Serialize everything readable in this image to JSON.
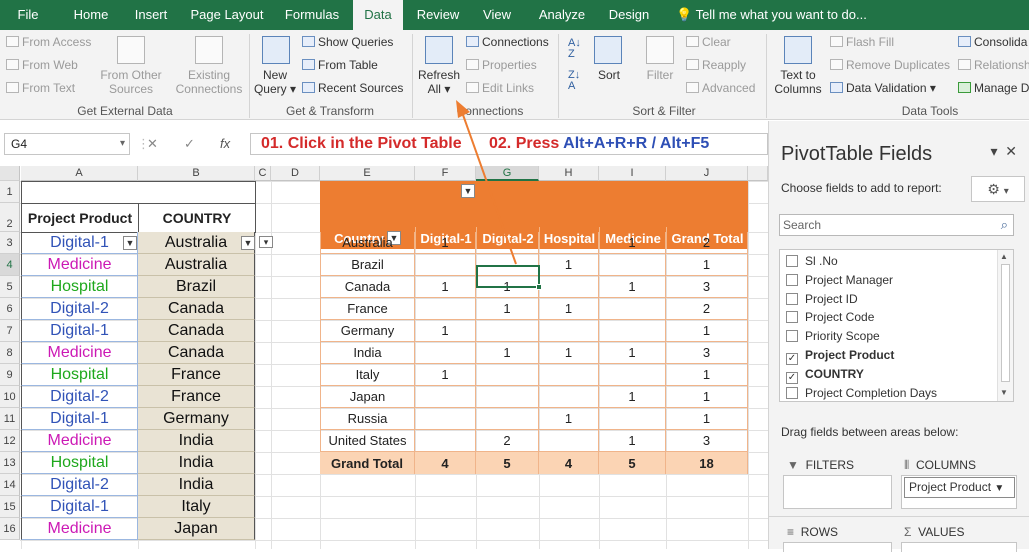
{
  "tabs": [
    {
      "label": "File",
      "active": false
    },
    {
      "label": "Home",
      "active": false
    },
    {
      "label": "Insert",
      "active": false
    },
    {
      "label": "Page Layout",
      "active": false
    },
    {
      "label": "Formulas",
      "active": false
    },
    {
      "label": "Data",
      "active": true
    },
    {
      "label": "Review",
      "active": false
    },
    {
      "label": "View",
      "active": false
    },
    {
      "label": "Analyze",
      "active": false
    },
    {
      "label": "Design",
      "active": false
    }
  ],
  "tell_me": "Tell me what you want to do...",
  "ribbon": {
    "get_external": {
      "from_access": "From Access",
      "from_web": "From Web",
      "from_text": "From Text",
      "from_other_1": "From Other",
      "from_other_2": "Sources",
      "existing_1": "Existing",
      "existing_2": "Connections",
      "group": "Get External Data"
    },
    "get_transform": {
      "new_query_1": "New",
      "new_query_2": "Query",
      "show_queries": "Show Queries",
      "from_table": "From Table",
      "recent_sources": "Recent Sources",
      "group": "Get & Transform"
    },
    "connections": {
      "refresh_1": "Refresh",
      "refresh_2": "All",
      "connections": "Connections",
      "properties": "Properties",
      "edit_links": "Edit Links",
      "group": "Connections"
    },
    "sort_filter": {
      "sort": "Sort",
      "filter": "Filter",
      "clear": "Clear",
      "reapply": "Reapply",
      "advanced": "Advanced",
      "group": "Sort & Filter"
    },
    "data_tools": {
      "text_to_1": "Text to",
      "text_to_2": "Columns",
      "flash_fill": "Flash Fill",
      "remove_duplicates": "Remove Duplicates",
      "data_validation": "Data Validation",
      "consolidate": "Consolida",
      "relationships": "Relationsh",
      "manage": "Manage D",
      "group": "Data Tools"
    }
  },
  "formula_bar": {
    "name_box": "G4",
    "fx": "fx",
    "cancel": "✕",
    "enter": "✓"
  },
  "instructions": {
    "step1": "01. Click in the Pivot Table",
    "step2_prefix": "02. Press ",
    "step2_key": "Alt+A+R+R",
    "step2_sep": " / ",
    "step2_key2": "Alt+F5"
  },
  "columns": [
    "A",
    "B",
    "C",
    "D",
    "E",
    "F",
    "G",
    "H",
    "I",
    "J"
  ],
  "rows": [
    "1",
    "2",
    "3",
    "4",
    "5",
    "6",
    "7",
    "8",
    "9",
    "10",
    "11",
    "12",
    "13",
    "14",
    "15",
    "16"
  ],
  "source_table": {
    "header_product": "Project Product",
    "header_country": "COUNTRY",
    "products": [
      "Digital-1",
      "Medicine",
      "Hospital",
      "Digital-2",
      "Digital-1",
      "Medicine",
      "Hospital",
      "Digital-2",
      "Digital-1",
      "Medicine",
      "Hospital",
      "Digital-2",
      "Digital-1",
      "Medicine"
    ],
    "countries": [
      "Australia",
      "Australia",
      "Brazil",
      "Canada",
      "Canada",
      "Canada",
      "France",
      "France",
      "Germany",
      "India",
      "India",
      "India",
      "Italy",
      "Japan"
    ]
  },
  "pivot": {
    "headers": [
      "Country",
      "Digital-1",
      "Digital-2",
      "Hospital",
      "Medicine",
      "Grand Total"
    ],
    "rows": [
      [
        "Australia",
        "1",
        "",
        "",
        "1",
        "2"
      ],
      [
        "Brazil",
        "",
        "",
        "1",
        "",
        "1"
      ],
      [
        "Canada",
        "1",
        "1",
        "",
        "1",
        "3"
      ],
      [
        "France",
        "",
        "1",
        "1",
        "",
        "2"
      ],
      [
        "Germany",
        "1",
        "",
        "",
        "",
        "1"
      ],
      [
        "India",
        "",
        "1",
        "1",
        "1",
        "3"
      ],
      [
        "Italy",
        "1",
        "",
        "",
        "",
        "1"
      ],
      [
        "Japan",
        "",
        "",
        "",
        "1",
        "1"
      ],
      [
        "Russia",
        "",
        "",
        "1",
        "",
        "1"
      ],
      [
        "United States",
        "",
        "2",
        "",
        "1",
        "3"
      ]
    ],
    "total": [
      "Grand Total",
      "4",
      "5",
      "4",
      "5",
      "18"
    ]
  },
  "pane": {
    "title": "PivotTable Fields",
    "subtitle": "Choose fields to add to report:",
    "search_placeholder": "Search",
    "fields": [
      {
        "name": "Sl .No",
        "checked": false
      },
      {
        "name": "Project Manager",
        "checked": false
      },
      {
        "name": "Project ID",
        "checked": false
      },
      {
        "name": "Project Code",
        "checked": false
      },
      {
        "name": "Priority Scope",
        "checked": false
      },
      {
        "name": "Project Product",
        "checked": true
      },
      {
        "name": "COUNTRY",
        "checked": true
      },
      {
        "name": "Project Completion Days",
        "checked": false
      }
    ],
    "drag_text": "Drag fields between areas below:",
    "filters": "FILTERS",
    "columns": "COLUMNS",
    "rows": "ROWS",
    "values": "VALUES",
    "columns_item": "Project Product"
  },
  "colors": {
    "excel_green": "#217346",
    "pivot_orange": "#ed7d31",
    "pivot_total": "#fbd4b4",
    "digital": "#3153b7",
    "medicine": "#cc19b5",
    "hospital": "#1ea81c",
    "instruction_red": "#d42a2a",
    "instruction_key": "#2e4fb5"
  }
}
